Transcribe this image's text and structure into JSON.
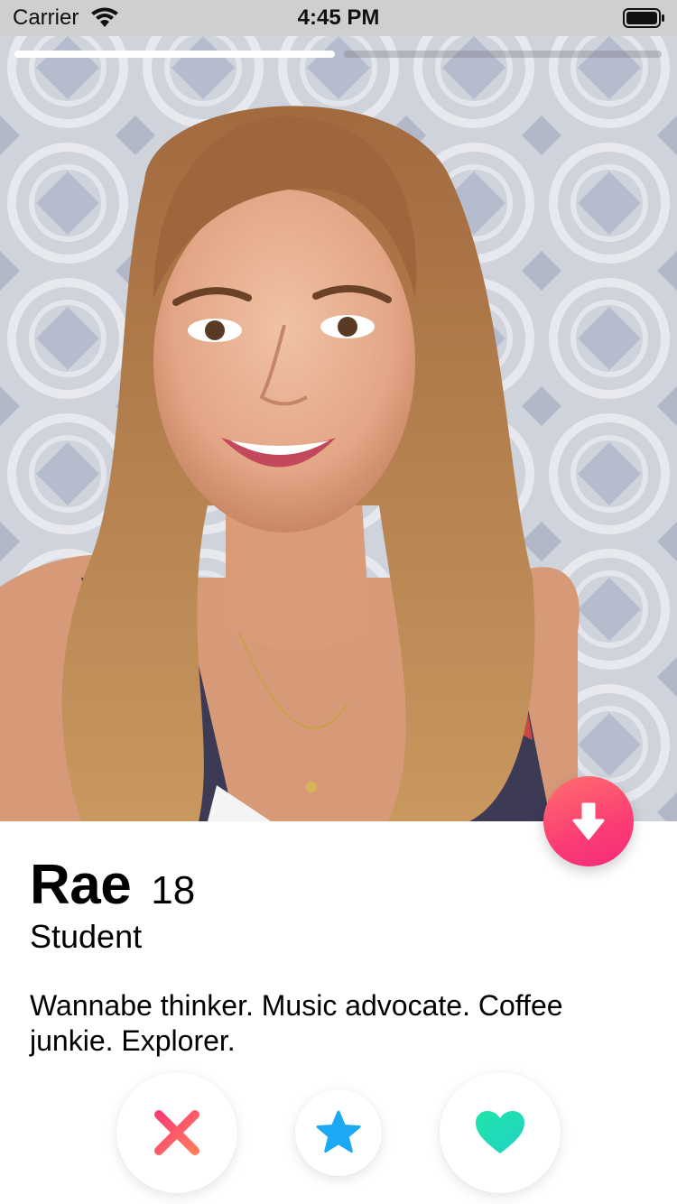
{
  "status_bar": {
    "carrier": "Carrier",
    "time": "4:45 PM",
    "wifi_icon": "wifi-icon",
    "battery_icon": "battery-icon"
  },
  "photos": {
    "current_index": 1,
    "total": 2
  },
  "profile": {
    "name": "Rae",
    "age": "18",
    "job": "Student",
    "bio": "Wannabe thinker. Music advocate. Coffee junkie. Explorer."
  },
  "buttons": {
    "collapse_icon": "arrow-down-icon",
    "nope_icon": "x-icon",
    "super_like_icon": "star-icon",
    "like_icon": "heart-icon"
  },
  "colors": {
    "accent_pink": "#fb3d74",
    "nope_gradient": [
      "#fb3d74",
      "#ff7a5c"
    ],
    "star_blue": "#1ca9f4",
    "like_green": "#1fe0b5"
  }
}
